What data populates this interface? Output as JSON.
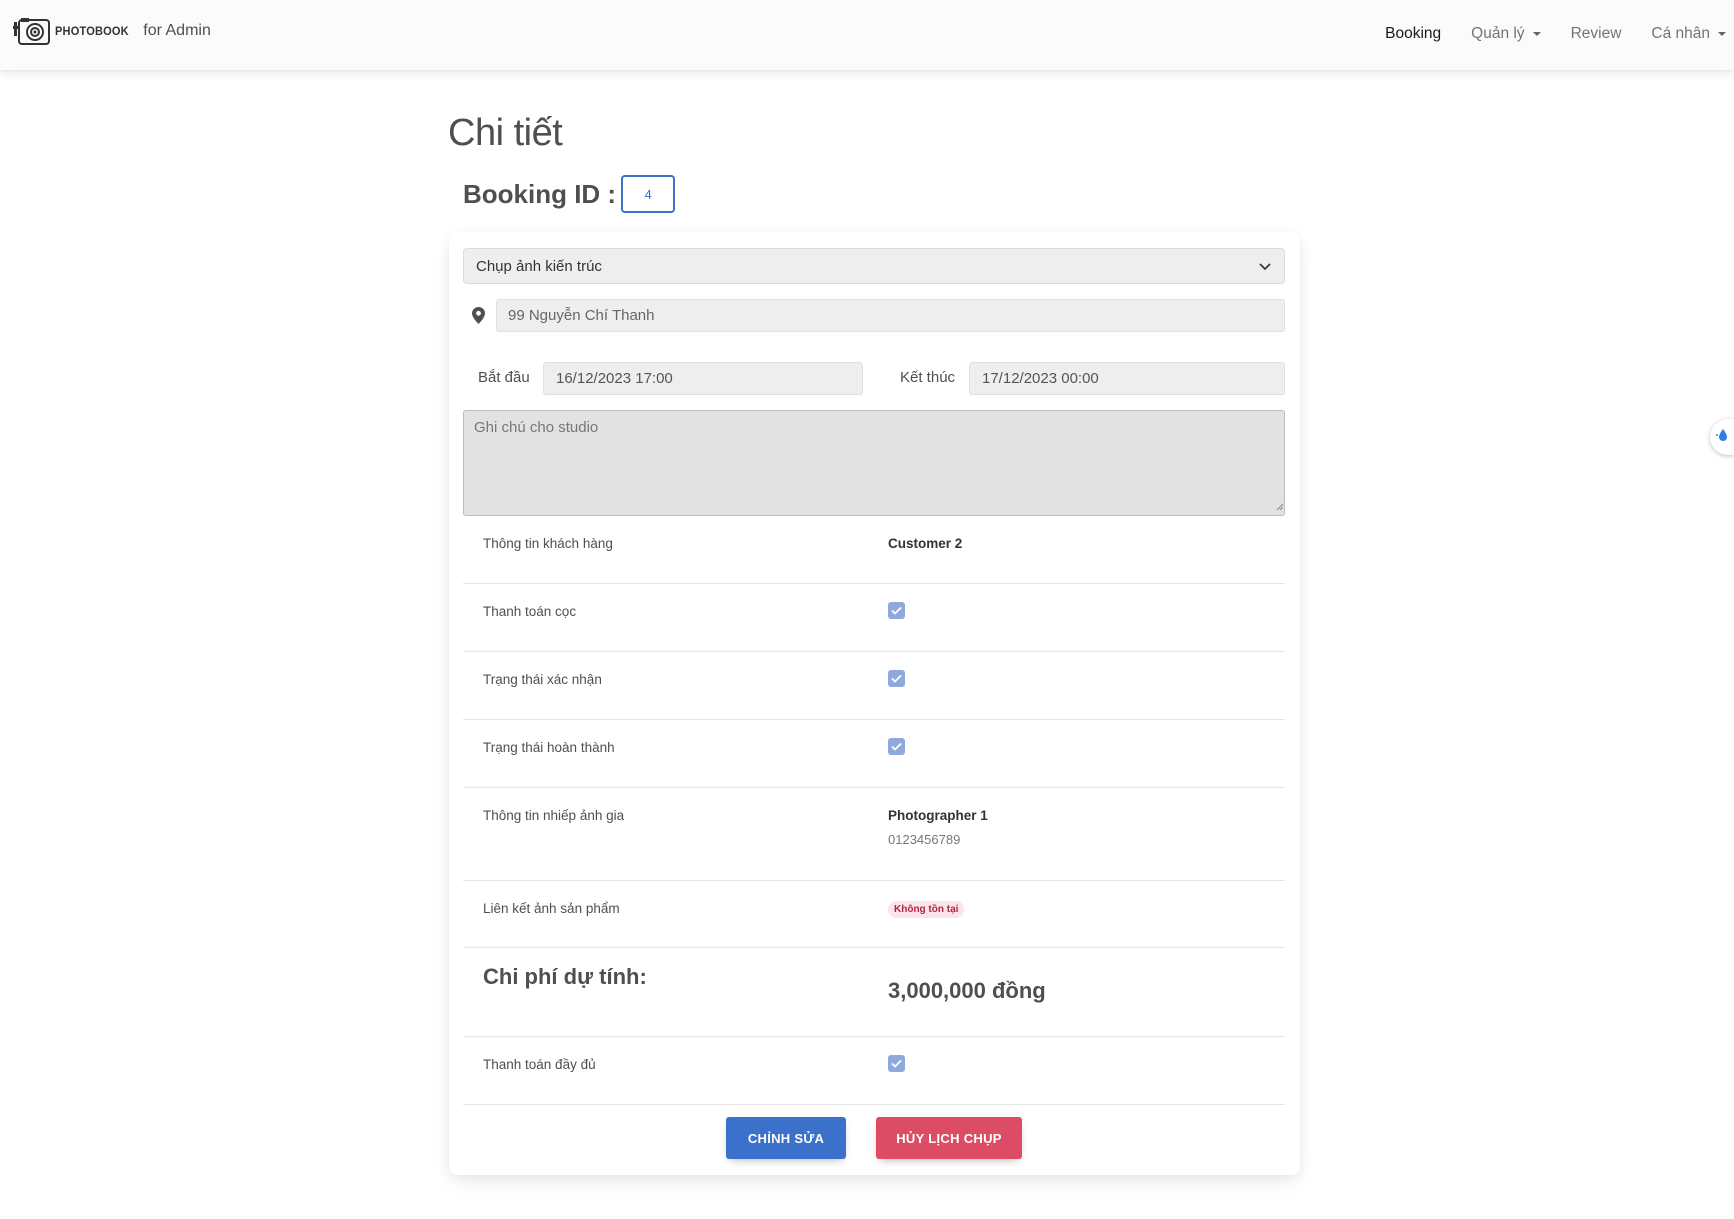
{
  "navbar": {
    "brand_name": "PHOTOBOOK",
    "brand_sub": "for Admin",
    "links": [
      {
        "label": "Booking",
        "active": true,
        "dropdown": false
      },
      {
        "label": "Quản lý",
        "active": false,
        "dropdown": true
      },
      {
        "label": "Review",
        "active": false,
        "dropdown": false
      },
      {
        "label": "Cá nhân",
        "active": false,
        "dropdown": true
      }
    ]
  },
  "page": {
    "title": "Chi tiết",
    "booking_id_label": "Booking ID :",
    "booking_id": "4"
  },
  "form": {
    "service_type": "Chụp ảnh kiến trúc",
    "address": "99 Nguyễn Chí Thanh",
    "start_label": "Bắt đầu",
    "start_value": "16/12/2023 17:00",
    "end_label": "Kết thúc",
    "end_value": "17/12/2023 00:00",
    "note_placeholder": "Ghi chú cho studio"
  },
  "details": {
    "customer_label": "Thông tin khách hàng",
    "customer_name": "Customer 2",
    "deposit_label": "Thanh toán cọc",
    "deposit_paid": true,
    "confirm_label": "Trạng thái xác nhận",
    "confirmed": true,
    "complete_label": "Trạng thái hoàn thành",
    "completed": true,
    "photographer_label": "Thông tin nhiếp ảnh gia",
    "photographer_name": "Photographer 1",
    "photographer_phone": "0123456789",
    "link_label": "Liên kết ảnh sản phẩm",
    "link_status": "Không tồn tại",
    "cost_label": "Chi phí dự tính:",
    "cost_value": "3,000,000 đồng",
    "full_payment_label": "Thanh toán đầy đủ",
    "full_paid": true
  },
  "actions": {
    "edit_label": "CHỈNH SỬA",
    "cancel_label": "HỦY LỊCH CHỤP"
  },
  "colors": {
    "primary": "#3b71ca",
    "danger": "#dc4c64",
    "checkbox": "#8fa9dc"
  }
}
